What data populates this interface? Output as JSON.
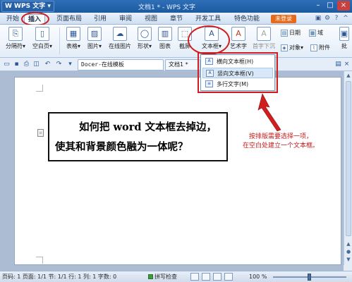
{
  "titlebar": {
    "app_name": "W WPS 文字 ▾",
    "doc_title": "文档1 * - WPS 文字"
  },
  "menu": {
    "tabs": [
      {
        "label": "开始"
      },
      {
        "label": "插入"
      },
      {
        "label": "页面布局"
      },
      {
        "label": "引用"
      },
      {
        "label": "审阅"
      },
      {
        "label": "视图"
      },
      {
        "label": "章节"
      },
      {
        "label": "开发工具"
      },
      {
        "label": "特色功能"
      }
    ],
    "active_tab": "插入",
    "unlogged": "未登录"
  },
  "ribbon": {
    "buttons": {
      "page_break": "分隔符▾",
      "blank_page": "空白页▾",
      "table": "表格▾",
      "picture": "图片▾",
      "online_picture": "在线图片",
      "shape": "形状▾",
      "chart": "图表",
      "screenshot": "截屏",
      "textbox": "文本框▾",
      "art_text": "艺术字",
      "dropcap": "首字下沉",
      "date": "日期",
      "object": "对象▾",
      "attachment": "附件",
      "field": "域",
      "batch": "批"
    }
  },
  "tabs": {
    "docer": "Docer-在线模板",
    "doc1": "文档1 *"
  },
  "dropdown": {
    "items": [
      {
        "label": "横向文本框(H)"
      },
      {
        "label": "竖向文本框(V)"
      },
      {
        "label": "多行文字(M)"
      }
    ]
  },
  "document": {
    "textbox_line1": "如何把 word 文本框去掉边，",
    "textbox_line2": "使其和背景颜色融为一体呢？"
  },
  "annotation": {
    "line1": "按排版需要选择一项，",
    "line2": "在空白处建立一个文本框。"
  },
  "statusbar": {
    "info": "页码: 1  页面: 1/1  节: 1/1  行: 1  列: 1  字数: 0",
    "spell": "拼写检查",
    "zoom": "100 %"
  },
  "colors": {
    "annotation_red": "#d01e1e",
    "title_blue": "#1d5aa0"
  }
}
